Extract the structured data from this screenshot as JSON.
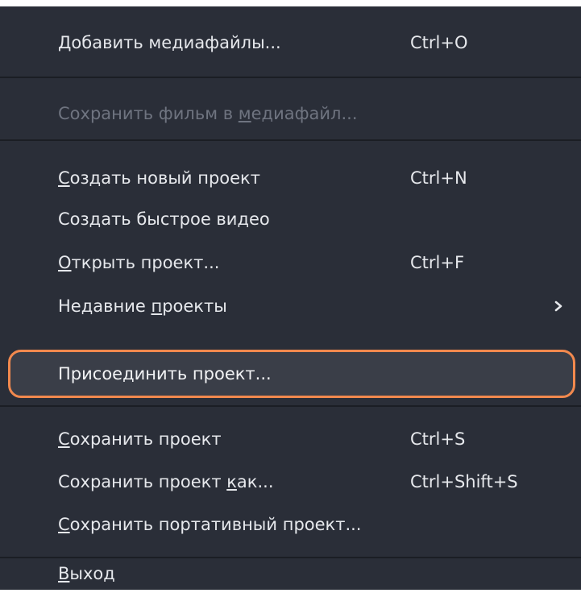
{
  "menu": {
    "items": [
      {
        "id": "add-media",
        "label_pre": "",
        "label_ul": "Д",
        "label_post": "обавить медиафайлы...",
        "shortcut": "Ctrl+O"
      },
      {
        "id": "save-movie",
        "label_pre": "Сохранить фильм в ",
        "label_ul": "м",
        "label_post": "едиафайл...",
        "shortcut": ""
      },
      {
        "id": "new-project",
        "label_pre": "",
        "label_ul": "С",
        "label_post": "оздать новый проект",
        "shortcut": "Ctrl+N"
      },
      {
        "id": "quick-video",
        "label_pre": "Создать быстрое видео",
        "label_ul": "",
        "label_post": "",
        "shortcut": ""
      },
      {
        "id": "open-project",
        "label_pre": "",
        "label_ul": "О",
        "label_post": "ткрыть проект...",
        "shortcut": "Ctrl+F"
      },
      {
        "id": "recent-projects",
        "label_pre": "Недавние ",
        "label_ul": "п",
        "label_post": "роекты",
        "shortcut": ""
      },
      {
        "id": "attach-project",
        "label_pre": "Присоединить проект...",
        "label_ul": "",
        "label_post": "",
        "shortcut": ""
      },
      {
        "id": "save-project",
        "label_pre": "",
        "label_ul": "С",
        "label_post": "охранить проект",
        "shortcut": "Ctrl+S"
      },
      {
        "id": "save-project-as",
        "label_pre": "Сохранить проект ",
        "label_ul": "к",
        "label_post": "ак...",
        "shortcut": "Ctrl+Shift+S"
      },
      {
        "id": "save-portable",
        "label_pre": "",
        "label_ul": "С",
        "label_post": "охранить портативный проект...",
        "shortcut": ""
      },
      {
        "id": "exit",
        "label_pre": "",
        "label_ul": "В",
        "label_post": "ыход",
        "shortcut": ""
      }
    ],
    "disabled_item": "save-movie",
    "highlighted_item": "attach-project",
    "submenu_icon": "chevron-right-icon",
    "colors": {
      "background": "#2a2e38",
      "text": "#e6e8ec",
      "disabled_text": "#6f7480",
      "highlight_border": "#f2894e",
      "separator": "#1b1e24"
    }
  }
}
